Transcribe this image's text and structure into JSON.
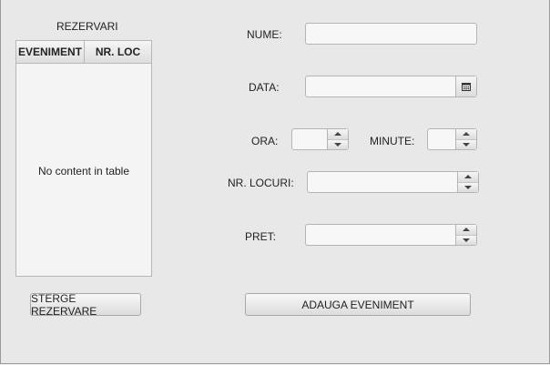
{
  "reservations": {
    "title": "REZERVARI",
    "columns": [
      "EVENIMENT",
      "NR. LOC"
    ],
    "empty_text": "No content in table",
    "delete_button": "STERGE REZERVARE"
  },
  "form": {
    "name_label": "NUME:",
    "date_label": "DATA:",
    "hour_label": "ORA:",
    "minute_label": "MINUTE:",
    "seats_label": "NR. LOCURI:",
    "price_label": "PRET:",
    "add_button": "ADAUGA EVENIMENT",
    "name_value": "",
    "date_value": "",
    "hour_value": "",
    "minute_value": "",
    "seats_value": "",
    "price_value": ""
  },
  "icons": {
    "date_picker": "calendar-icon",
    "increment": "arrow-up-icon",
    "decrement": "arrow-down-icon"
  }
}
